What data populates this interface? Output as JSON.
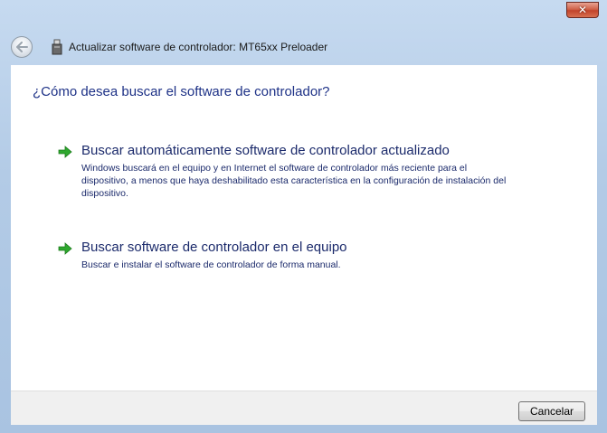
{
  "window": {
    "title": "Actualizar software de controlador: MT65xx Preloader",
    "close_glyph": "✕"
  },
  "main": {
    "question": "¿Cómo desea buscar el software de controlador?",
    "options": [
      {
        "title": "Buscar automáticamente software de controlador actualizado",
        "description": "Windows buscará en el equipo y en Internet el software de controlador más reciente para el dispositivo, a menos que haya deshabilitado esta característica en la configuración de instalación del dispositivo."
      },
      {
        "title": "Buscar software de controlador en el equipo",
        "description": "Buscar e instalar el software de controlador de forma manual."
      }
    ]
  },
  "footer": {
    "cancel_label": "Cancelar"
  },
  "icons": {
    "back": "back-arrow-icon",
    "device": "usb-device-icon",
    "option_arrow": "green-arrow-icon",
    "close": "close-icon"
  },
  "colors": {
    "heading": "#1e3287",
    "link_text": "#1b2a6b",
    "arrow_green": "#2ea82e",
    "close_red": "#c2432a",
    "frame_blue": "#b3cbe6"
  }
}
